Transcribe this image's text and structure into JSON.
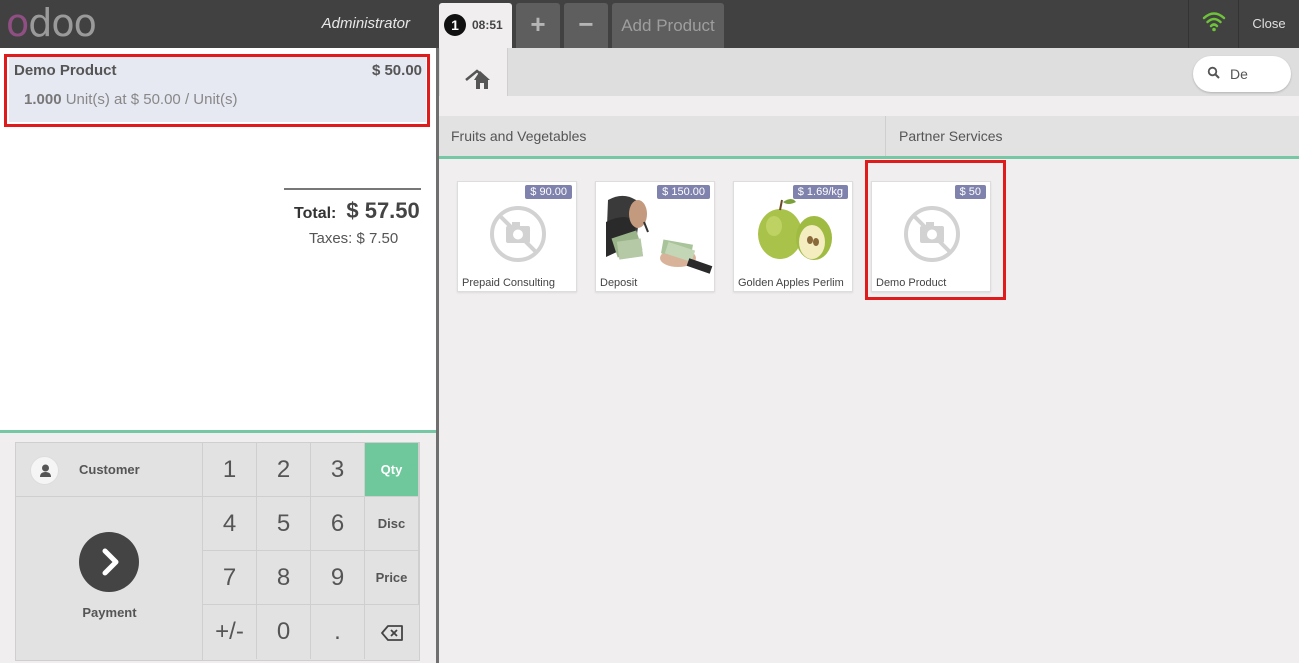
{
  "topbar": {
    "logo": "odoo",
    "cashier": "Administrator",
    "order_number": "1",
    "order_time": "08:51",
    "new_order_label": "+",
    "delete_order_label": "−",
    "add_product_label": "Add Product",
    "close_label": "Close"
  },
  "order": {
    "line": {
      "name": "Demo Product",
      "price": "$ 50.00",
      "qty": "1.000",
      "detail": "Unit(s) at $ 50.00 / Unit(s)"
    },
    "total_label": "Total:",
    "total_value": "$ 57.50",
    "taxes": "Taxes: $ 7.50"
  },
  "pad": {
    "customer": "Customer",
    "payment": "Payment",
    "keys": [
      "1",
      "2",
      "3",
      "4",
      "5",
      "6",
      "7",
      "8",
      "9",
      "+/-",
      "0",
      "."
    ],
    "modes": [
      "Qty",
      "Disc",
      "Price"
    ],
    "selected_mode": "Qty"
  },
  "search": {
    "value": "De"
  },
  "categories": [
    "Fruits and Vegetables",
    "Partner Services"
  ],
  "products": [
    {
      "name": "Prepaid Consulting",
      "price": "$ 90.00",
      "image": "no-image-icon"
    },
    {
      "name": "Deposit",
      "price": "$ 150.00",
      "image": "money-photo"
    },
    {
      "name": "Golden Apples Perlim",
      "price": "$ 1.69/kg",
      "image": "apples-photo"
    },
    {
      "name": "Demo Product",
      "price": "$ 50",
      "image": "no-image-icon"
    }
  ],
  "colors": {
    "accent": "#76c7a4",
    "highlight": "#e01b1b",
    "topbar": "#414141",
    "price_badge": "#7f82ac"
  }
}
